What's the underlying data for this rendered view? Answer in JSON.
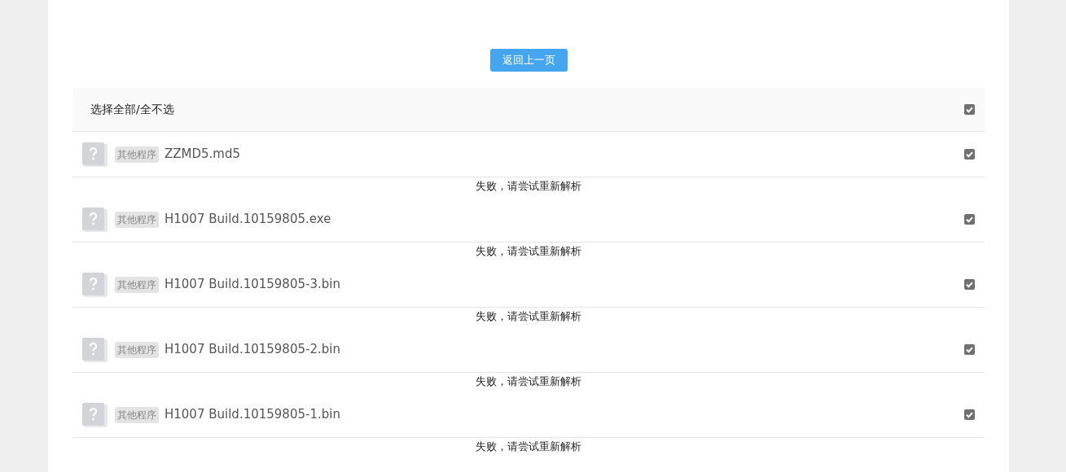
{
  "back_button": "返回上一页",
  "select_all": {
    "label": "选择全部/全不选",
    "checked": true
  },
  "files": [
    {
      "tag": "其他程序",
      "name": "ZZMD5.md5",
      "checked": true,
      "status": "失败，请尝试重新解析"
    },
    {
      "tag": "其他程序",
      "name": "H1007 Build.10159805.exe",
      "checked": true,
      "status": "失败，请尝试重新解析"
    },
    {
      "tag": "其他程序",
      "name": "H1007 Build.10159805-3.bin",
      "checked": true,
      "status": "失败，请尝试重新解析"
    },
    {
      "tag": "其他程序",
      "name": "H1007 Build.10159805-2.bin",
      "checked": true,
      "status": "失败，请尝试重新解析"
    },
    {
      "tag": "其他程序",
      "name": "H1007 Build.10159805-1.bin",
      "checked": true,
      "status": "失败，请尝试重新解析"
    }
  ]
}
